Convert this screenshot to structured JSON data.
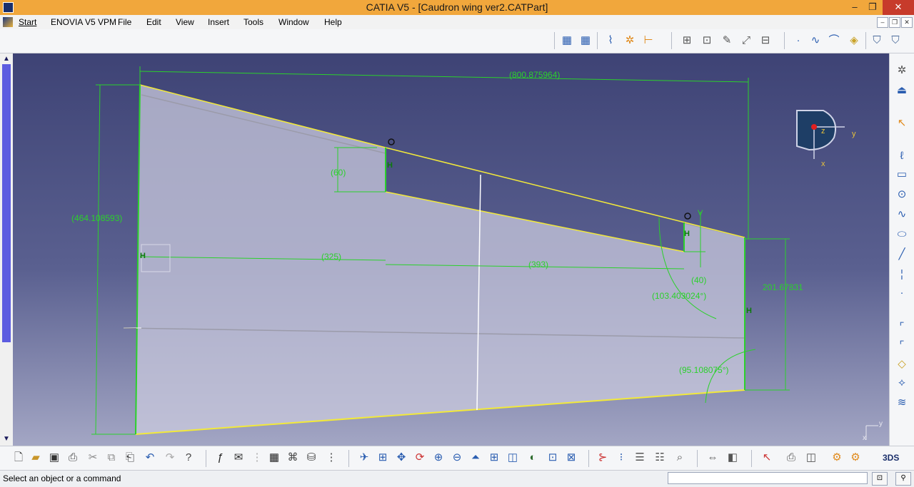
{
  "window": {
    "title": "CATIA V5 - [Caudron wing ver2.CATPart]",
    "minimize": "–",
    "restore": "❐",
    "close": "✕"
  },
  "menubar": {
    "items": [
      "Start",
      "ENOVIA V5 VPM",
      "File",
      "Edit",
      "View",
      "Insert",
      "Tools",
      "Window",
      "Help"
    ],
    "mdi": [
      "–",
      "❐",
      "✕"
    ]
  },
  "sketch": {
    "dimensions": {
      "overall_width": "(800.875964)",
      "overall_height": "(464.108593)",
      "step1_drop": "(60)",
      "inboard_len": "(325)",
      "mid_len": "(393)",
      "step2_drop": "(40)",
      "tip_height": "201.67831",
      "angle_upper": "(103.403024°)",
      "angle_lower": "(95.108075°)"
    },
    "constraint_marks": {
      "horizontal": "H",
      "vertical": "V"
    },
    "compass_labels": {
      "x": "x",
      "y": "y",
      "z": "z"
    },
    "corner_axes": {
      "x": "x",
      "y": "y"
    },
    "colors": {
      "profile": "#f2e93a",
      "dimension": "#2bd12b",
      "construction": "#111111",
      "axis": "#ffffff",
      "background": "#3e4375"
    }
  },
  "status": {
    "prompt": "Select an object or a command",
    "command_value": ""
  },
  "toolbar_icons": {
    "top": [
      "grid-icon",
      "snap-grid-icon",
      "construction-icon",
      "geometric-constraints-icon",
      "dimensional-constraints-icon",
      "profile-icon",
      "rectangle-icon",
      "circle-icon",
      "spline-icon",
      "conic-icon",
      "line-icon",
      "point-icon",
      "corner-icon",
      "chamfer-icon",
      "trim-icon",
      "mirror-icon",
      "project-icon",
      "exit-sketch-icon",
      "update-icon"
    ],
    "bottom": [
      "new-icon",
      "open-icon",
      "save-icon",
      "print-icon",
      "cut-icon",
      "copy-icon",
      "paste-icon",
      "undo-icon",
      "redo-icon",
      "help-icon",
      "formula-icon",
      "knowledge-icon",
      "table-icon",
      "tree-icon",
      "catalog-icon",
      "fly-icon",
      "fit-all-icon",
      "pan-icon",
      "rotate-icon",
      "zoom-in-icon",
      "zoom-out-icon",
      "normal-view-icon",
      "multi-view-icon",
      "iso-view-icon",
      "shading-icon",
      "hide-show-icon",
      "swap-icon",
      "measure-icon",
      "analyze-icon",
      "constraint-analysis-icon",
      "sketch-analysis-icon",
      "sketch-solving-icon"
    ]
  }
}
